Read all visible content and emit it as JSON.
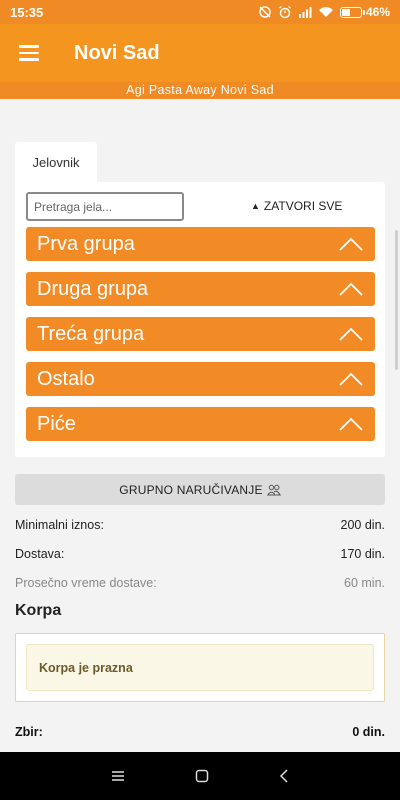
{
  "status_bar": {
    "time": "15:35",
    "battery_percent": "46%",
    "battery_level": 0.46
  },
  "app_bar": {
    "title": "Novi Sad",
    "menu_icon": "hamburger-menu-icon"
  },
  "restaurant_name": "Agi Pasta Away Novi Sad",
  "menu": {
    "tab_label": "Jelovnik",
    "search_placeholder": "Pretraga jela...",
    "collapse_all_label": "ZATVORI SVE",
    "groups": [
      {
        "label": "Prva grupa"
      },
      {
        "label": "Druga grupa"
      },
      {
        "label": "Treća grupa"
      },
      {
        "label": "Ostalo"
      },
      {
        "label": "Piće"
      }
    ]
  },
  "group_order_label": "GRUPNO NARUČIVANJE",
  "info": {
    "min_label": "Minimalni iznos:",
    "min_value": "200 din.",
    "delivery_label": "Dostava:",
    "delivery_value": "170 din.",
    "avg_time_label": "Prosečno vreme dostave:",
    "avg_time_value": "60 min."
  },
  "cart": {
    "title": "Korpa",
    "empty_message": "Korpa je prazna"
  },
  "total": {
    "label": "Zbir:",
    "value": "0 din."
  },
  "colors": {
    "accent": "#f4951f",
    "group_bg": "#f28b25"
  }
}
